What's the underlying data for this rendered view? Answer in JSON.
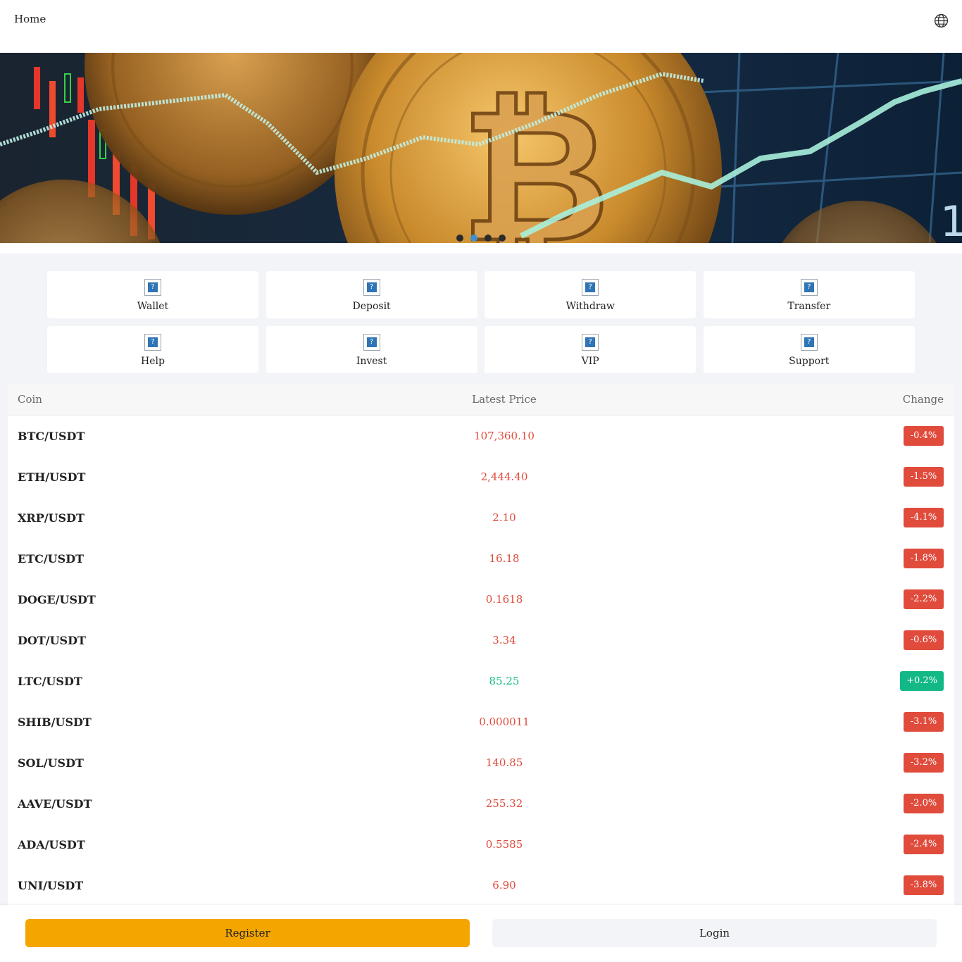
{
  "header": {
    "title": "Home",
    "language_icon": "globe-icon"
  },
  "banner": {
    "slide_count": 4,
    "active_index": 1
  },
  "quick_actions": [
    {
      "label": "Wallet",
      "icon": "broken-image-icon"
    },
    {
      "label": "Deposit",
      "icon": "broken-image-icon"
    },
    {
      "label": "Withdraw",
      "icon": "broken-image-icon"
    },
    {
      "label": "Transfer",
      "icon": "broken-image-icon"
    },
    {
      "label": "Help",
      "icon": "broken-image-icon"
    },
    {
      "label": "Invest",
      "icon": "broken-image-icon"
    },
    {
      "label": "VIP",
      "icon": "broken-image-icon"
    },
    {
      "label": "Support",
      "icon": "broken-image-icon"
    }
  ],
  "market": {
    "columns": [
      "Coin",
      "Latest Price",
      "Change"
    ],
    "rows": [
      {
        "pair": "BTC/USDT",
        "price": "107,360.10",
        "change": "-0.4%",
        "direction": "down"
      },
      {
        "pair": "ETH/USDT",
        "price": "2,444.40",
        "change": "-1.5%",
        "direction": "down"
      },
      {
        "pair": "XRP/USDT",
        "price": "2.10",
        "change": "-4.1%",
        "direction": "down"
      },
      {
        "pair": "ETC/USDT",
        "price": "16.18",
        "change": "-1.8%",
        "direction": "down"
      },
      {
        "pair": "DOGE/USDT",
        "price": "0.1618",
        "change": "-2.2%",
        "direction": "down"
      },
      {
        "pair": "DOT/USDT",
        "price": "3.34",
        "change": "-0.6%",
        "direction": "down"
      },
      {
        "pair": "LTC/USDT",
        "price": "85.25",
        "change": "+0.2%",
        "direction": "up"
      },
      {
        "pair": "SHIB/USDT",
        "price": "0.000011",
        "change": "-3.1%",
        "direction": "down"
      },
      {
        "pair": "SOL/USDT",
        "price": "140.85",
        "change": "-3.2%",
        "direction": "down"
      },
      {
        "pair": "AAVE/USDT",
        "price": "255.32",
        "change": "-2.0%",
        "direction": "down"
      },
      {
        "pair": "ADA/USDT",
        "price": "0.5585",
        "change": "-2.4%",
        "direction": "down"
      },
      {
        "pair": "UNI/USDT",
        "price": "6.90",
        "change": "-3.8%",
        "direction": "down"
      }
    ]
  },
  "footer": {
    "register_label": "Register",
    "login_label": "Login"
  },
  "colors": {
    "down": "#e04b3c",
    "up": "#12b886",
    "register": "#f5a500",
    "active_dot": "#3f8fd1"
  }
}
